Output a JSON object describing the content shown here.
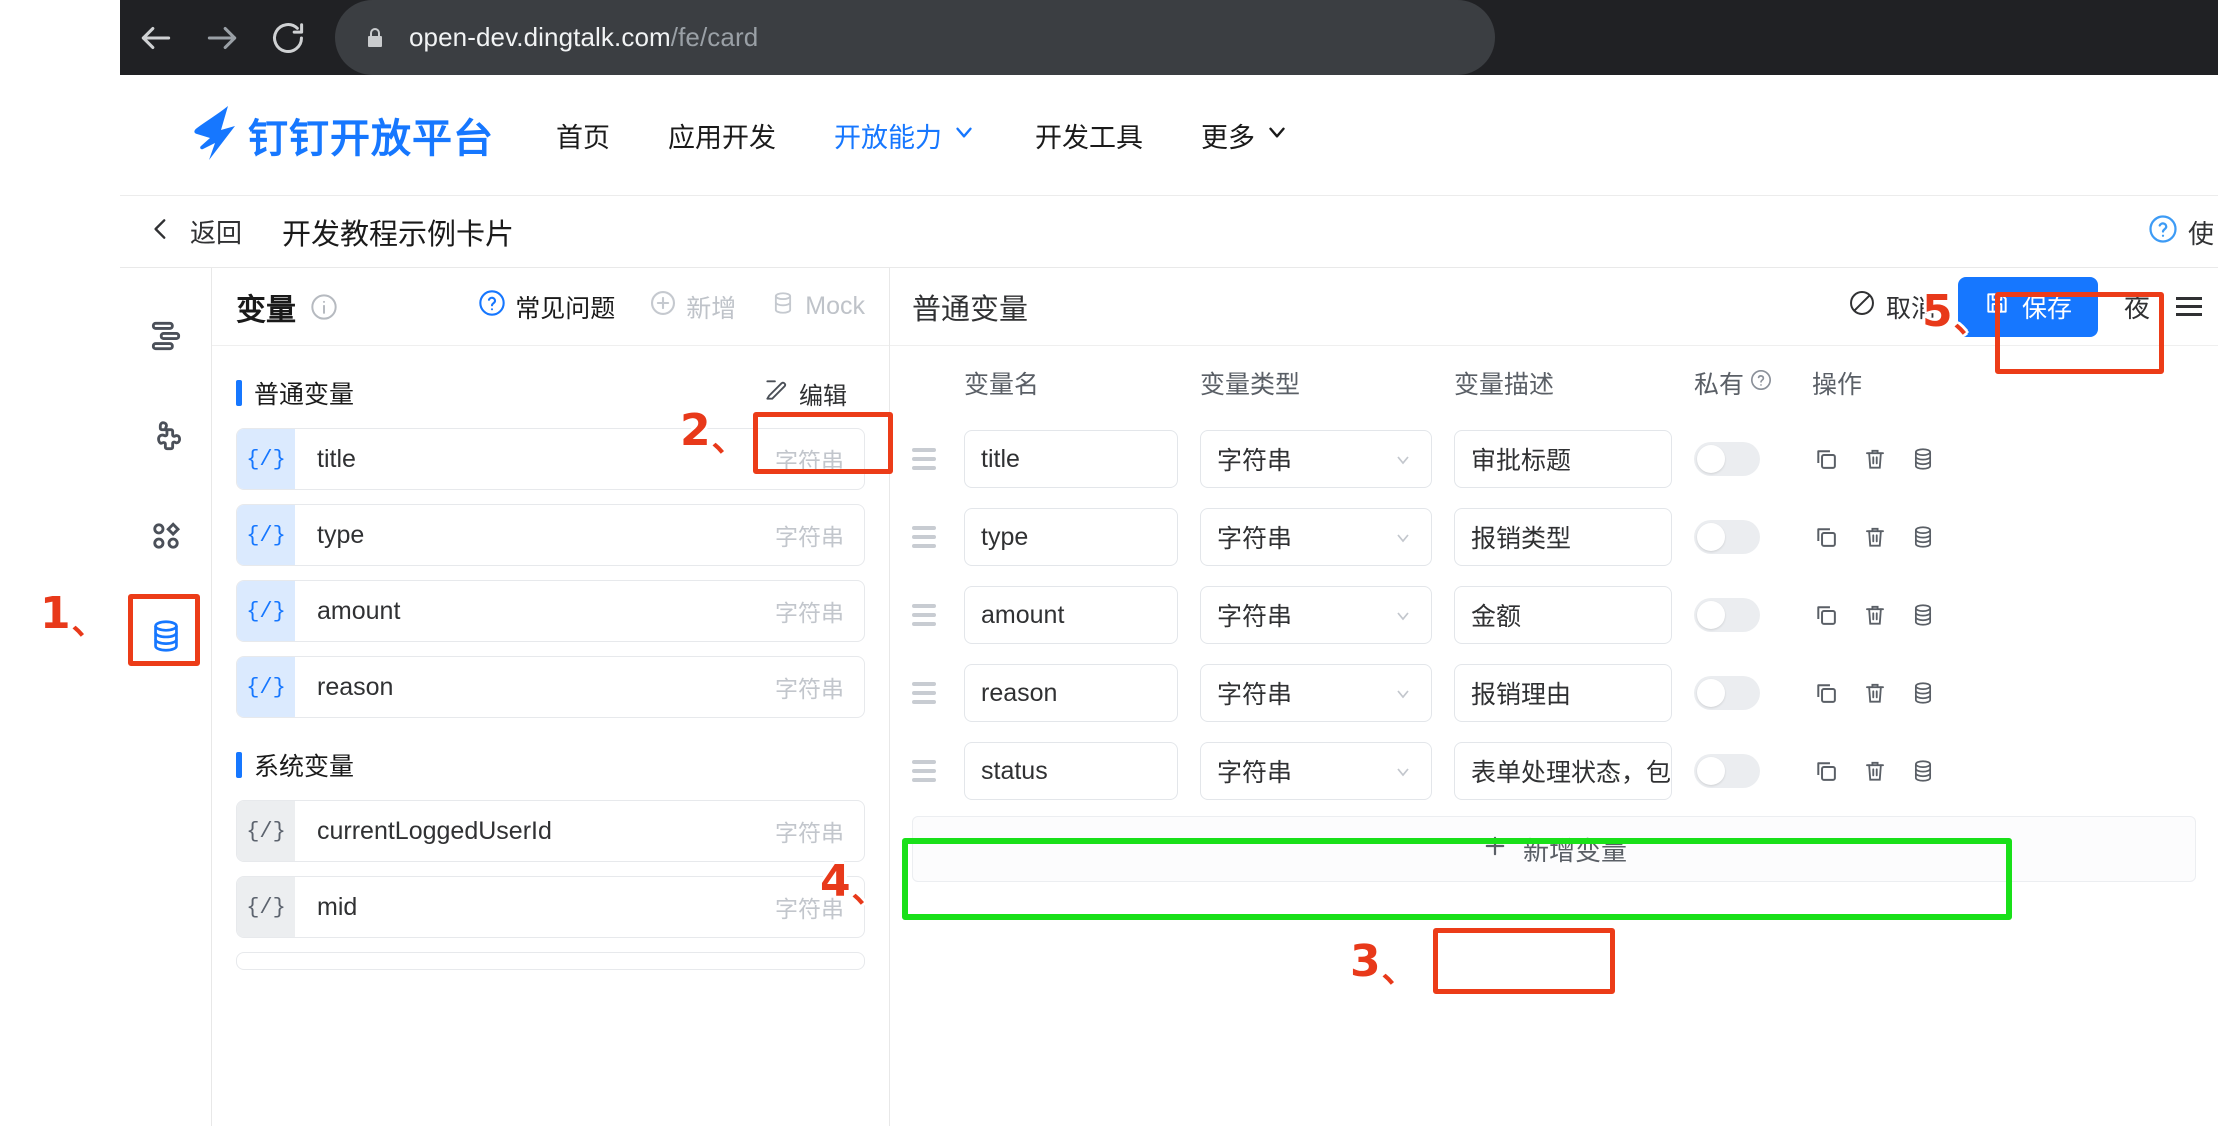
{
  "browser": {
    "back_icon": "arrow-left-icon",
    "forward_icon": "arrow-right-icon",
    "reload_icon": "reload-icon",
    "lock_icon": "lock-icon",
    "url_host": "open-dev.dingtalk.com",
    "url_path": "/fe/card"
  },
  "site_header": {
    "brand": "钉钉开放平台",
    "nav": [
      {
        "label": "首页",
        "active": false,
        "caret": false
      },
      {
        "label": "应用开发",
        "active": false,
        "caret": false
      },
      {
        "label": "开放能力",
        "active": true,
        "caret": true
      },
      {
        "label": "开发工具",
        "active": false,
        "caret": false
      },
      {
        "label": "更多",
        "active": false,
        "caret": true
      }
    ]
  },
  "crumb": {
    "back_label": "返回",
    "title": "开发教程示例卡片",
    "help_label": "使"
  },
  "rail": {
    "items": [
      {
        "name": "layout-icon",
        "selected": false
      },
      {
        "name": "puzzle-icon",
        "selected": false
      },
      {
        "name": "apps-grid-icon",
        "selected": false
      },
      {
        "name": "database-icon",
        "selected": true
      }
    ]
  },
  "var_panel": {
    "title": "变量",
    "info_icon": "info-icon",
    "actions": [
      {
        "label": "常见问题",
        "icon": "question-circle-icon",
        "muted": false
      },
      {
        "label": "新增",
        "icon": "plus-circle-icon",
        "muted": true
      },
      {
        "label": "Mock",
        "icon": "database-icon",
        "muted": true
      }
    ],
    "sections": [
      {
        "title": "普通变量",
        "edit_label": "编辑",
        "edit_icon": "edit-icon",
        "has_edit": true,
        "kind": "normal",
        "items": [
          {
            "tag": "{/}",
            "name": "title",
            "type": "字符串"
          },
          {
            "tag": "{/}",
            "name": "type",
            "type": "字符串"
          },
          {
            "tag": "{/}",
            "name": "amount",
            "type": "字符串"
          },
          {
            "tag": "{/}",
            "name": "reason",
            "type": "字符串"
          }
        ]
      },
      {
        "title": "系统变量",
        "edit_label": "",
        "has_edit": false,
        "kind": "system",
        "items": [
          {
            "tag": "{/}",
            "name": "currentLoggedUserId",
            "type": "字符串"
          },
          {
            "tag": "{/}",
            "name": "mid",
            "type": "字符串"
          }
        ]
      }
    ]
  },
  "main": {
    "title": "普通变量",
    "cancel_label": "取消",
    "cancel_icon": "ban-icon",
    "save_label": "保存",
    "save_icon": "floppy-icon",
    "night_label": "夜",
    "accent_color": "#1677ff",
    "table": {
      "headers": {
        "name": "变量名",
        "type": "变量类型",
        "desc": "变量描述",
        "private": "私有",
        "private_icon": "question-circle-icon",
        "ops": "操作"
      },
      "rows": [
        {
          "name": "title",
          "type": "字符串",
          "desc": "审批标题",
          "private": false,
          "highlight": false
        },
        {
          "name": "type",
          "type": "字符串",
          "desc": "报销类型",
          "private": false,
          "highlight": false
        },
        {
          "name": "amount",
          "type": "字符串",
          "desc": "金额",
          "private": false,
          "highlight": false
        },
        {
          "name": "reason",
          "type": "字符串",
          "desc": "报销理由",
          "private": false,
          "highlight": false
        },
        {
          "name": "status",
          "type": "字符串",
          "desc": "表单处理状态，包含",
          "private": false,
          "highlight": true
        }
      ],
      "row_ops": [
        "copy-icon",
        "trash-icon",
        "database-icon"
      ],
      "add_label": "新增变量",
      "add_icon": "plus-icon"
    }
  },
  "annotations": [
    {
      "number": "1"
    },
    {
      "number": "2"
    },
    {
      "number": "3"
    },
    {
      "number": "4"
    },
    {
      "number": "5"
    }
  ]
}
